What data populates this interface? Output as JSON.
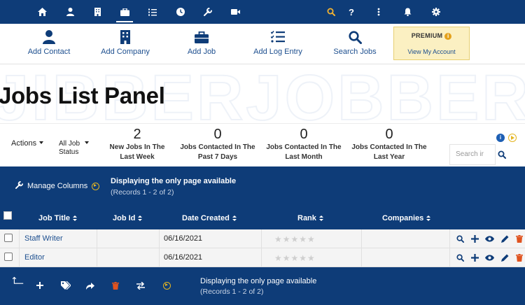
{
  "topnav": {
    "icons": [
      "home-icon",
      "user-icon",
      "building-icon",
      "briefcase-icon",
      "list-check-icon",
      "clock-icon",
      "wrench-icon",
      "video-icon",
      "search-icon",
      "help-icon",
      "more-vertical-icon",
      "bell-icon",
      "gear-icon"
    ],
    "active": "briefcase-icon",
    "help_label": "?"
  },
  "toolbar": {
    "items": [
      {
        "label": "Add Contact",
        "icon": "user-icon"
      },
      {
        "label": "Add Company",
        "icon": "building-icon"
      },
      {
        "label": "Add Job",
        "icon": "briefcase-icon"
      },
      {
        "label": "Add Log Entry",
        "icon": "list-check-icon"
      },
      {
        "label": "Search Jobs",
        "icon": "search-icon"
      }
    ],
    "premium_title": "PREMIUM",
    "premium_info": "i",
    "premium_link": "View My Account"
  },
  "watermark": "JIBBERJOBBER",
  "page_title": "Jobs List Panel",
  "stats": {
    "actions_label": "Actions",
    "filter_line1": "All Job",
    "filter_line2": "Status",
    "items": [
      {
        "value": "2",
        "line1": "New Jobs In The",
        "line2": "Last Week"
      },
      {
        "value": "0",
        "line1": "Jobs Contacted In The",
        "line2": "Past 7 Days"
      },
      {
        "value": "0",
        "line1": "Jobs Contacted In The",
        "line2": "Last Month"
      },
      {
        "value": "0",
        "line1": "Jobs Contacted In The",
        "line2": "Last Year"
      }
    ],
    "info_label": "i",
    "search_placeholder": "Search ir"
  },
  "band": {
    "manage_columns": "Manage Columns",
    "display_title": "Displaying the only page available",
    "display_sub": "(Records 1 - 2 of 2)"
  },
  "table": {
    "columns": [
      "Job Title",
      "Job Id",
      "Date Created",
      "Rank",
      "Companies"
    ],
    "rows": [
      {
        "title": "Staff Writer",
        "job_id": "",
        "date": "06/16/2021",
        "rank": 0,
        "companies": ""
      },
      {
        "title": "Editor",
        "job_id": "",
        "date": "06/16/2021",
        "rank": 0,
        "companies": ""
      }
    ],
    "row_actions": [
      "search-icon",
      "plus-icon",
      "eye-icon",
      "pencil-icon",
      "trash-icon"
    ],
    "stars": "★★★★★"
  },
  "footer": {
    "icons": [
      "corner-arrow-icon",
      "plus-icon",
      "tags-icon",
      "share-icon",
      "trash-icon",
      "swap-icon",
      "play-icon"
    ],
    "display_title": "Displaying the only page available",
    "display_sub": "(Records 1 - 2 of 2)"
  },
  "colors": {
    "navy": "#0e3c78",
    "gold": "#e4b521",
    "premium_bg": "#fbf0c2",
    "delete": "#e0531f",
    "link": "#1d4f8f"
  }
}
